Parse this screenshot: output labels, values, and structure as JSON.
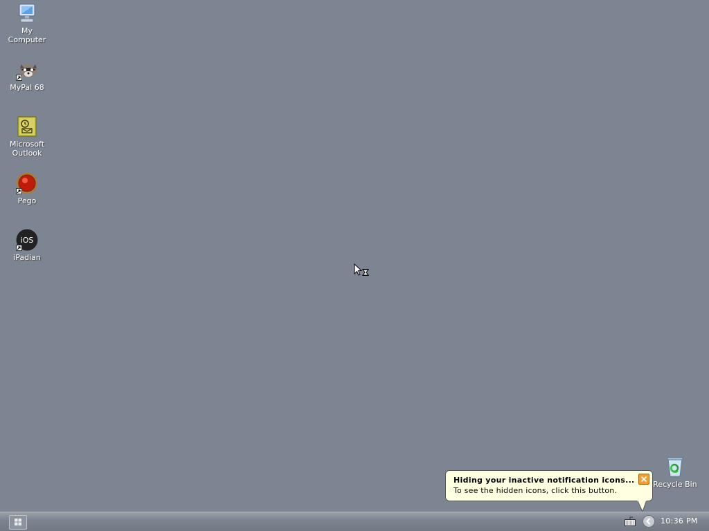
{
  "desktop": {
    "background_color": "#7d8592",
    "icons": [
      {
        "label": "My\nComputer",
        "icon": "computer-icon"
      },
      {
        "label": "MyPal 68",
        "icon": "raccoon-icon"
      },
      {
        "label": "Microsoft\nOutlook",
        "icon": "outlook-icon"
      },
      {
        "label": "Pego",
        "icon": "pego-icon"
      },
      {
        "label": "iPadian",
        "icon": "ios-icon",
        "glyph_text": "iOS"
      },
      {
        "label": "Recycle Bin",
        "icon": "recycle-bin-icon"
      }
    ]
  },
  "balloon": {
    "title": "Hiding your inactive notification icons...",
    "text": "To see the hidden icons, click this button.",
    "background": "#ffffe1"
  },
  "taskbar": {
    "clock": "10:36 PM",
    "start_icon": "start-grid-icon",
    "tray_icons": [
      "keyboard-icon",
      "show-hidden-icons-chevron-icon"
    ]
  }
}
